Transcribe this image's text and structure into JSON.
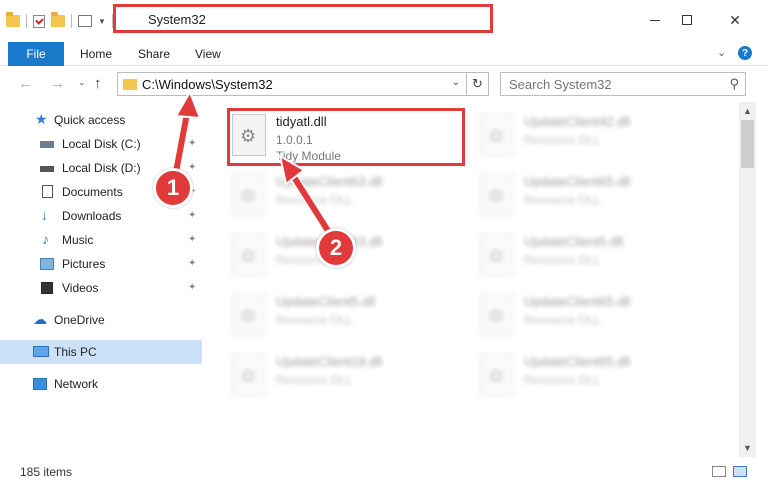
{
  "window": {
    "title": "System32"
  },
  "ribbon": {
    "tabs": [
      "File",
      "Home",
      "Share",
      "View"
    ],
    "help_label": "?"
  },
  "navbar": {
    "address": "C:\\Windows\\System32",
    "search_placeholder": "Search System32"
  },
  "sidebar": {
    "items": [
      {
        "label": "Quick access",
        "icon": "star-icon",
        "pinned": false
      },
      {
        "label": "Local Disk (C:)",
        "icon": "drive-icon",
        "pinned": true
      },
      {
        "label": "Local Disk (D:)",
        "icon": "drive-icon",
        "pinned": true
      },
      {
        "label": "Documents",
        "icon": "documents-icon",
        "pinned": true
      },
      {
        "label": "Downloads",
        "icon": "download-icon",
        "pinned": true
      },
      {
        "label": "Music",
        "icon": "music-icon",
        "pinned": true
      },
      {
        "label": "Pictures",
        "icon": "pictures-icon",
        "pinned": true
      },
      {
        "label": "Videos",
        "icon": "videos-icon",
        "pinned": true
      },
      {
        "label": "OneDrive",
        "icon": "onedrive-icon",
        "pinned": false
      },
      {
        "label": "This PC",
        "icon": "this-pc-icon",
        "pinned": false,
        "selected": true
      },
      {
        "label": "Network",
        "icon": "network-icon",
        "pinned": false
      }
    ]
  },
  "files": [
    {
      "name": "tidyatl.dll",
      "sub1": "1.0.0.1",
      "sub2": "Tidy Module",
      "highlighted": true
    },
    {
      "name": "UpdateClient42.dll",
      "sub1": "Resource DLL",
      "sub2": ""
    },
    {
      "name": "UpdateClient63.dll",
      "sub1": "Resource DLL",
      "sub2": ""
    },
    {
      "name": "UpdateClient65.dll",
      "sub1": "Resource DLL",
      "sub2": ""
    },
    {
      "name": "UpdateClient63.dll",
      "sub1": "Resource DLL",
      "sub2": ""
    },
    {
      "name": "UpdateClient5.dll",
      "sub1": "Resource DLL",
      "sub2": ""
    },
    {
      "name": "UpdateClient5.dll",
      "sub1": "Resource DLL",
      "sub2": ""
    },
    {
      "name": "UpdateClient65.dll",
      "sub1": "Resource DLL",
      "sub2": ""
    },
    {
      "name": "UpdateClient19.dll",
      "sub1": "Resource DLL",
      "sub2": ""
    },
    {
      "name": "UpdateClient65.dll",
      "sub1": "Resource DLL",
      "sub2": ""
    }
  ],
  "status": {
    "item_count": "185 items"
  },
  "callouts": [
    "1",
    "2"
  ],
  "colors": {
    "accent": "#1979ca",
    "highlight": "#e13a3a",
    "selected_bg": "#cce1f7"
  }
}
